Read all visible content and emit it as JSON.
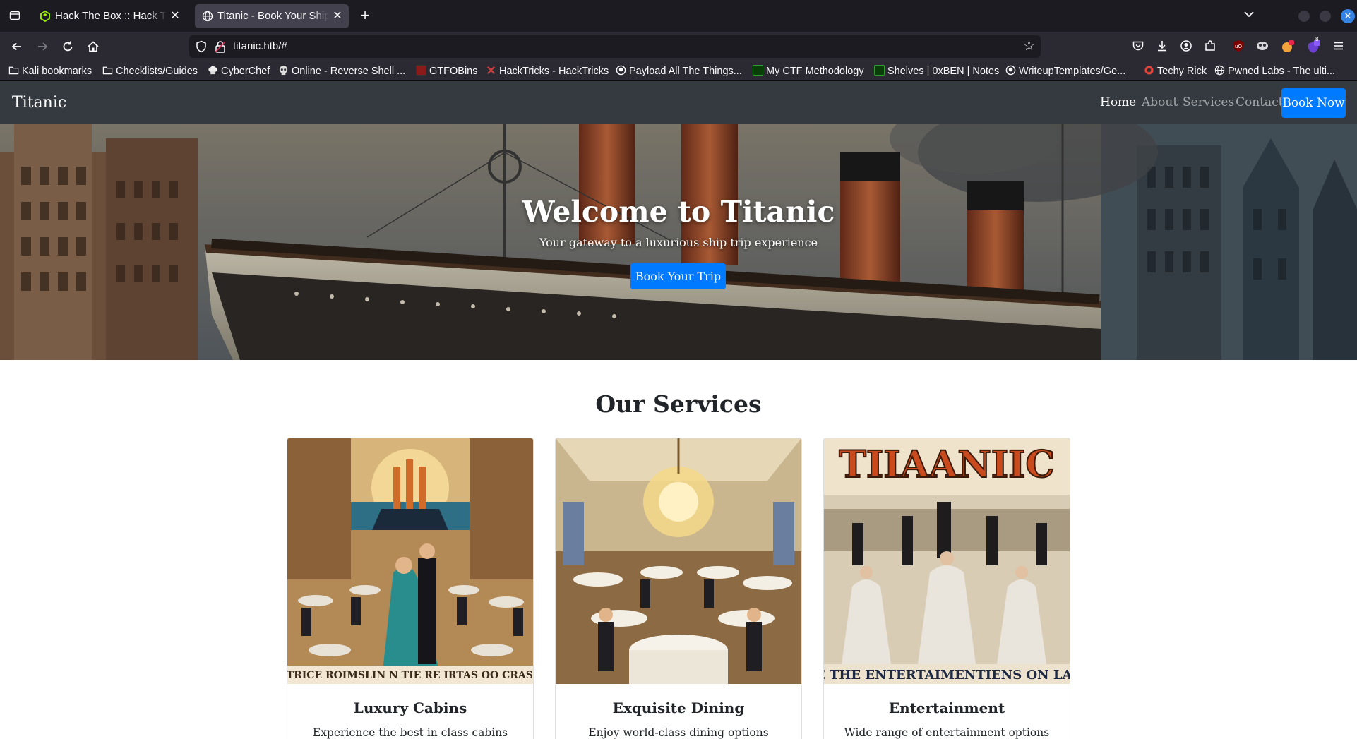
{
  "browser": {
    "tabs": [
      {
        "title": "Hack The Box :: Hack The Box",
        "active": false
      },
      {
        "title": "Titanic - Book Your Ship Trip",
        "active": true
      }
    ],
    "url": "titanic.htb/#",
    "bookmarks": [
      "Kali bookmarks",
      "Checklists/Guides",
      "CyberChef",
      "Online - Reverse Shell ...",
      "GTFOBins",
      "HackTricks - HackTricks",
      "Payload All The Things...",
      "My CTF Methodology",
      "Shelves | 0xBEN | Notes",
      "WriteupTemplates/Ge...",
      "Techy Rick",
      "Pwned Labs - The ulti..."
    ],
    "extension_badge": "8"
  },
  "site": {
    "brand": "Titanic",
    "nav": {
      "home": "Home",
      "about": "About",
      "services": "Services",
      "contact": "Contact",
      "book_now": "Book Now"
    },
    "hero": {
      "title": "Welcome to Titanic",
      "subtitle": "Your gateway to a luxurious ship trip experience",
      "button": "Book Your Trip"
    },
    "services": {
      "title": "Our Services",
      "cards": [
        {
          "title": "Luxury Cabins",
          "text": "Experience the best in class cabins with all",
          "image_caption": "TTRICE ROIMSLIN N TIE RE IRTAS OO CRAS I"
        },
        {
          "title": "Exquisite Dining",
          "text": "Enjoy world-class dining options curated",
          "image_caption": ""
        },
        {
          "title": "Entertainment",
          "text": "Wide range of entertainment options for",
          "image_caption": "E THE ENTERTAIMENTIENS ON LAI",
          "image_heading": "TIIAANIIC"
        }
      ]
    }
  },
  "colors": {
    "chrome_dark": "#1c1b22",
    "chrome_toolbar": "#2b2a33",
    "site_nav": "#343a40",
    "primary": "#007bff"
  }
}
